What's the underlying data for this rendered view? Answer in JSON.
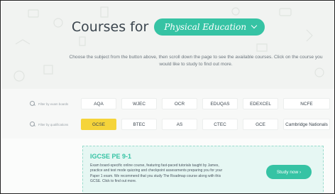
{
  "header": {
    "title": "Courses for",
    "subject_selected": "Physical Education",
    "description": "Choose the subject from the button above, then scroll down the page to see the available courses. Click on the course you would like to study to find out more."
  },
  "filters": {
    "exam_boards": {
      "label": "Filter by exam boards",
      "options": [
        "AQA",
        "WJEC",
        "OCR",
        "EDUQAS",
        "EDEXCEL",
        "NCFE"
      ]
    },
    "qualifications": {
      "label": "Filter by qualifications",
      "options": [
        "GCSE",
        "BTEC",
        "AS",
        "CTEC",
        "GCE",
        "Cambridge Nationals"
      ],
      "selected": "GCSE"
    }
  },
  "course": {
    "title": "IGCSE PE 9-1",
    "text": "Exam board-specific online course, featuring fast-paced tutorials taught by James, practice and test mode quizzing and checkpoint assessments preparing you for your Paper 1 exam. We recommend that you study The Roadmap course along with this GCSE. Click to find out more.",
    "cta": "Study now ›"
  },
  "colors": {
    "accent": "#36c3a4",
    "selected_chip": "#f5d43a",
    "hero_bg": "#f1f3f1"
  },
  "icons": {
    "filter": "search-icon",
    "dropdown": "chevron-down-icon"
  }
}
